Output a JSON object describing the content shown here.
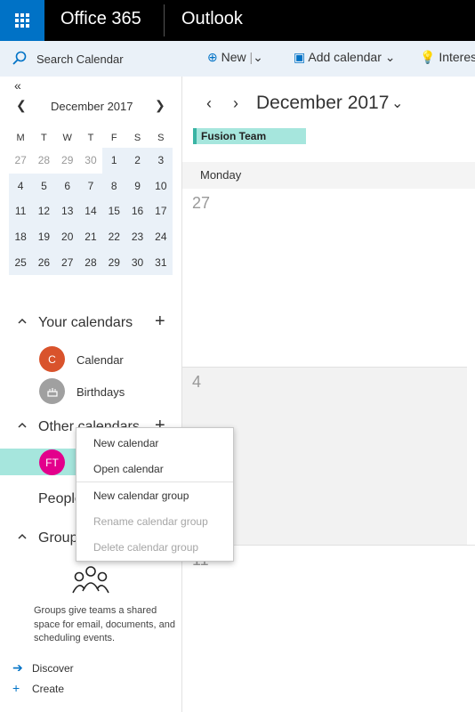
{
  "header": {
    "brand": "Office 365",
    "app": "Outlook"
  },
  "search": {
    "placeholder": "Search Calendar"
  },
  "toolbar": {
    "new_label": "New",
    "add_calendar_label": "Add calendar",
    "interesting_label": "Interes"
  },
  "mini_calendar": {
    "month_label": "December 2017",
    "weekdays": [
      "M",
      "T",
      "W",
      "T",
      "F",
      "S",
      "S"
    ],
    "weeks": [
      [
        "27",
        "28",
        "29",
        "30",
        "1",
        "2",
        "3"
      ],
      [
        "4",
        "5",
        "6",
        "7",
        "8",
        "9",
        "10"
      ],
      [
        "11",
        "12",
        "13",
        "14",
        "15",
        "16",
        "17"
      ],
      [
        "18",
        "19",
        "20",
        "21",
        "22",
        "23",
        "24"
      ],
      [
        "25",
        "26",
        "27",
        "28",
        "29",
        "30",
        "31"
      ]
    ]
  },
  "your_calendars": {
    "heading": "Your calendars",
    "items": [
      {
        "initial": "C",
        "label": "Calendar",
        "color": "#d9532c"
      },
      {
        "label": "Birthdays",
        "color": "#a0a0a0"
      }
    ]
  },
  "other_calendars": {
    "heading": "Other calendars",
    "items": [
      {
        "initials": "FT",
        "color": "#e3008c"
      }
    ]
  },
  "people": {
    "heading": "People"
  },
  "groups": {
    "heading": "Groups",
    "description": "Groups give teams a shared space for email, documents, and scheduling events.",
    "discover_label": "Discover",
    "create_label": "Create"
  },
  "main": {
    "month_label": "December 2017",
    "calendar_tag": "Fusion Team",
    "day_header": "Monday",
    "weeks": [
      "27",
      "4",
      "11"
    ]
  },
  "context_menu": {
    "items": [
      {
        "label": "New calendar",
        "enabled": true
      },
      {
        "label": "Open calendar",
        "enabled": true
      },
      {
        "label": "New calendar group",
        "enabled": true
      },
      {
        "label": "Rename calendar group",
        "enabled": false
      },
      {
        "label": "Delete calendar group",
        "enabled": false
      }
    ]
  },
  "colors": {
    "accent": "#0072c6",
    "selection": "#a6e6dd",
    "pane_bg": "#eaf1f8"
  }
}
